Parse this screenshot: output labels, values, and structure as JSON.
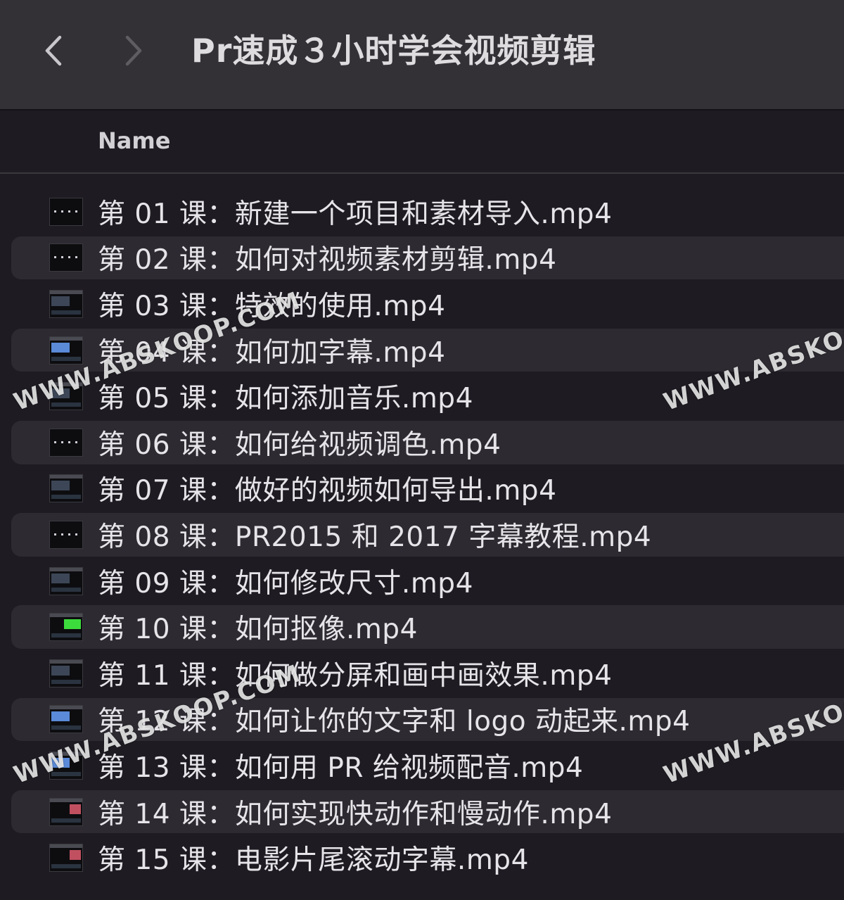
{
  "window": {
    "title": "Pr速成３小时学会视频剪辑"
  },
  "nav": {
    "back_icon": "chevron-left-icon",
    "forward_icon": "chevron-right-icon"
  },
  "columns": {
    "name": "Name"
  },
  "files": [
    {
      "name": "第 01 课：新建一个项目和素材导入.mp4",
      "thumb": "dark"
    },
    {
      "name": "第 02 课：如何对视频素材剪辑.mp4",
      "thumb": "dark"
    },
    {
      "name": "第 03 课：特效的使用.mp4",
      "thumb": "ui"
    },
    {
      "name": "第 04 课：如何加字幕.mp4",
      "thumb": "blue"
    },
    {
      "name": "第 05 课：如何添加音乐.mp4",
      "thumb": "ui"
    },
    {
      "name": "第 06 课：如何给视频调色.mp4",
      "thumb": "dark"
    },
    {
      "name": "第 07 课：做好的视频如何导出.mp4",
      "thumb": "ui"
    },
    {
      "name": "第 08 课：PR2015 和 2017 字幕教程.mp4",
      "thumb": "dark"
    },
    {
      "name": "第 09 课：如何修改尺寸.mp4",
      "thumb": "ui"
    },
    {
      "name": "第 10 课：如何抠像.mp4",
      "thumb": "green"
    },
    {
      "name": "第 11 课：如何做分屏和画中画效果.mp4",
      "thumb": "ui"
    },
    {
      "name": "第 12 课：如何让你的文字和 logo 动起来.mp4",
      "thumb": "blue"
    },
    {
      "name": "第 13 课：如何用 PR 给视频配音.mp4",
      "thumb": "blue"
    },
    {
      "name": "第 14 课：如何实现快动作和慢动作.mp4",
      "thumb": "red"
    },
    {
      "name": "第 15 课：电影片尾滚动字幕.mp4",
      "thumb": "red"
    }
  ],
  "watermarks": [
    "WWW.ABSKOOP.COM",
    "WWW.ABSKOOP.COM",
    "WWW.ABSKOOP.COM",
    "WWW.ABSKOOP.COM"
  ]
}
